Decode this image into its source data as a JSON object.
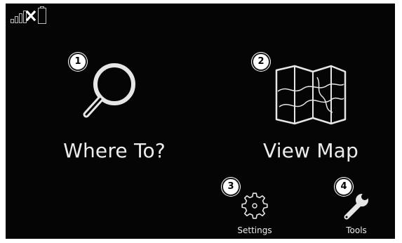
{
  "status": {
    "icon": "signal-bars-icon",
    "state_icon": "x-mark-icon",
    "battery_icon": "battery-icon"
  },
  "menu": {
    "where_to": {
      "label": "Where To?",
      "icon": "magnifier-icon",
      "callout": "1"
    },
    "view_map": {
      "label": "View Map",
      "icon": "map-icon",
      "callout": "2"
    },
    "settings": {
      "label": "Settings",
      "icon": "gear-icon",
      "callout": "3"
    },
    "tools": {
      "label": "Tools",
      "icon": "wrench-icon",
      "callout": "4"
    }
  },
  "colors": {
    "screen_background": "#050505",
    "icon_stroke": "#e6e6e6",
    "label_text": "#ececec",
    "callout_fill": "#ffffff"
  }
}
